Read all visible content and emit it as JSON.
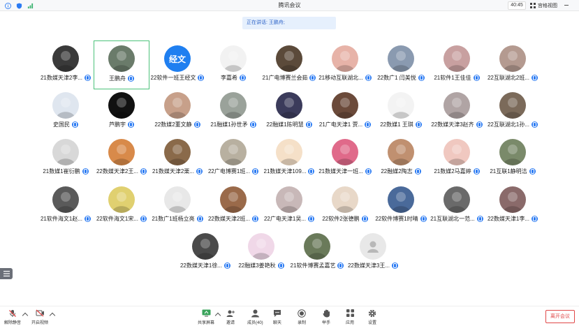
{
  "app": {
    "title": "腾讯会议",
    "timer": "40:45",
    "view_label": "宫格视图"
  },
  "speaking": {
    "text": "正在讲话: 王鹏舟;"
  },
  "colors": {
    "accent": "#2b7bf3",
    "active_border": "#4cc27a",
    "leave": "#e04848"
  },
  "participants": [
    {
      "name": "21数媒天津2李...",
      "bg": "#3a3a3a"
    },
    {
      "name": "王鹏舟",
      "bg": "#6a7b6a",
      "active": true
    },
    {
      "name": "22软件一班王经文",
      "bg": "#1f7ff0",
      "text": "经文"
    },
    {
      "name": "李嘉希",
      "bg": "#f2f2f2"
    },
    {
      "name": "21广电博赛兰会茹",
      "bg": "#5b4a3a"
    },
    {
      "name": "21移动互联湖北...",
      "bg": "#e7b3a8"
    },
    {
      "name": "22数广1 闫美悦",
      "bg": "#8a9ab0"
    },
    {
      "name": "21软件1王佳佳",
      "bg": "#c8a0a0"
    },
    {
      "name": "22互联湖北2班...",
      "bg": "#b49a90"
    },
    {
      "name": "史国民",
      "bg": "#dfe6ef"
    },
    {
      "name": "芦鹏宇",
      "bg": "#111111"
    },
    {
      "name": "22数媒2董文静",
      "bg": "#c7a08a"
    },
    {
      "name": "21融媒1孙世矛",
      "bg": "#9aa29a"
    },
    {
      "name": "22融媒1陈明慧",
      "bg": "#3b3b5b"
    },
    {
      "name": "21广电天津1 贾...",
      "bg": "#6b4a3a"
    },
    {
      "name": "22数媒1 王琪",
      "bg": "#f3f3f3"
    },
    {
      "name": "22数媒天津3赵齐",
      "bg": "#b0a4a4"
    },
    {
      "name": "22互联湖北1孙...",
      "bg": "#7b6a5a"
    },
    {
      "name": "21数媒1崔衍鹏",
      "bg": "#d8d8d8"
    },
    {
      "name": "22数媒天津2王...",
      "bg": "#d88a4a"
    },
    {
      "name": "21数媒天津2栗...",
      "bg": "#8a6a4a"
    },
    {
      "name": "22广电博赛1班...",
      "bg": "#b8b0a0"
    },
    {
      "name": "21数媒天津109...",
      "bg": "#f5e0c8"
    },
    {
      "name": "21数媒天津一班...",
      "bg": "#e06a8a"
    },
    {
      "name": "22融媒2陶志",
      "bg": "#c09070"
    },
    {
      "name": "21数媒2马嘉婷",
      "bg": "#f0c8c0"
    },
    {
      "name": "21互联1静明洁",
      "bg": "#7a8a6a"
    },
    {
      "name": "21软件海文1赵...",
      "bg": "#5a5a5a"
    },
    {
      "name": "22软件海文1宋...",
      "bg": "#e0d070"
    },
    {
      "name": "21数广1班杨立亮",
      "bg": "#e8e8e8"
    },
    {
      "name": "22数媒天津2班...",
      "bg": "#9a6a4a"
    },
    {
      "name": "22广电天津1吴...",
      "bg": "#c8b8b8"
    },
    {
      "name": "22软件2张德鹏",
      "bg": "#e8d8c8"
    },
    {
      "name": "22软件博赛1时晴",
      "bg": "#4a6a9a"
    },
    {
      "name": "21互联湖北一范...",
      "bg": "#6a6a6a"
    },
    {
      "name": "22数媒天津1李...",
      "bg": "#8a6a6a"
    },
    {
      "name": "22数媒天津1徐...",
      "bg": "#4a4a4a"
    },
    {
      "name": "22融媒3姜艳秋",
      "bg": "#f0d8e8"
    },
    {
      "name": "21软件博赛孟嘉艺",
      "bg": "#6a7a5a"
    },
    {
      "name": "22数媒天津3王...",
      "bg": "#e8e8e8",
      "placeholder": true
    }
  ],
  "toolbar": {
    "unmute": "解除静音",
    "start_video": "开启视频",
    "share_screen": "共享屏幕",
    "invite": "邀请",
    "members": "成员(40)",
    "chat": "聊天",
    "record": "录制",
    "raise_hand": "举手",
    "apps": "应用",
    "settings": "设置",
    "leave": "离开会议"
  }
}
